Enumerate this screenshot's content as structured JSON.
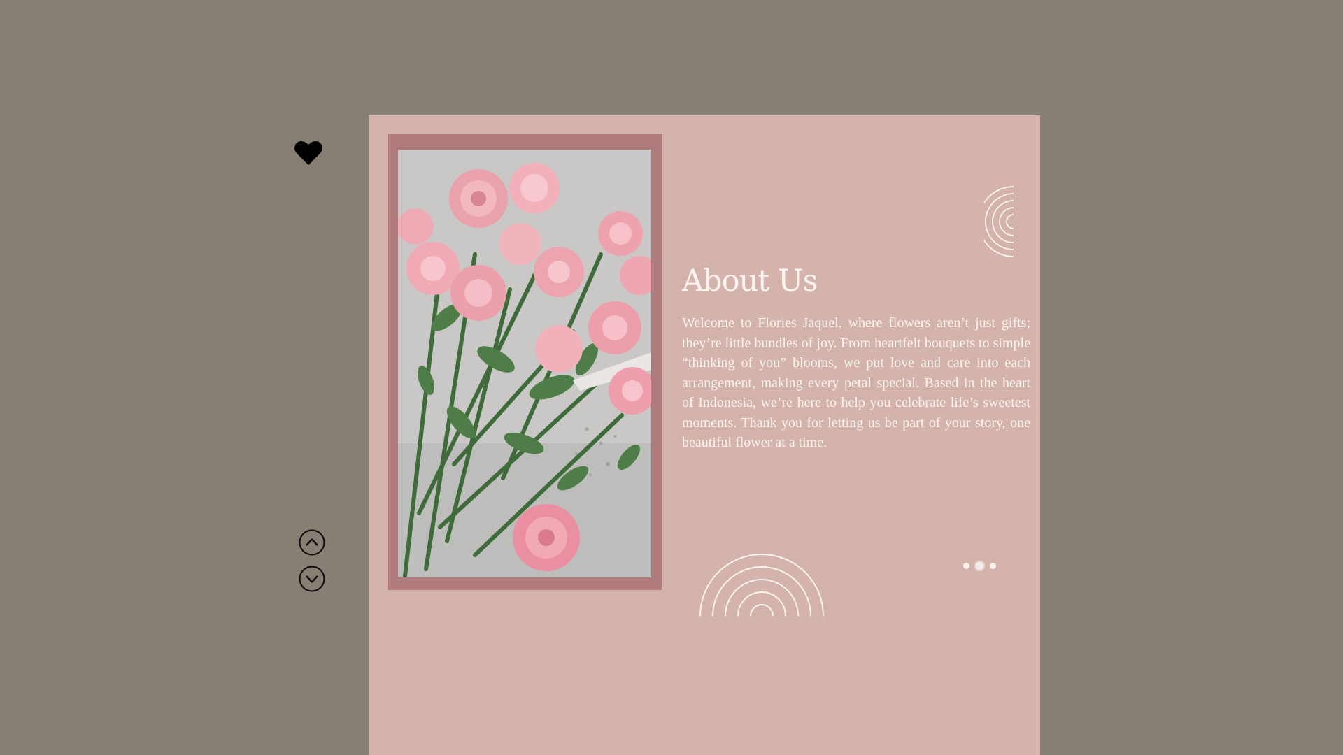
{
  "page": {
    "background_color": "#877e74",
    "card_color": "#d3b3ab",
    "frame_color": "#b07b7d",
    "text_color": "#fbf3ef"
  },
  "sidebar": {
    "favorite_icon": "heart-icon",
    "nav_up_icon": "chevron-up-circle-icon",
    "nav_down_icon": "chevron-down-circle-icon"
  },
  "about": {
    "title": "About Us",
    "body": "Welcome to Flories Jaquel, where flowers aren’t just gifts; they’re little bundles of joy. From heartfelt bouquets to simple “thinking of you” blooms, we put love and care into each arrangement, making every petal special. Based in the heart of Indonesia, we’re here to help you celebrate life’s sweetest moments. Thank you for letting us be part of your story, one beautiful flower at a time.",
    "image_subject": "pink roses bouquet photo"
  },
  "pagination": {
    "total": 3,
    "active_index": 1
  }
}
